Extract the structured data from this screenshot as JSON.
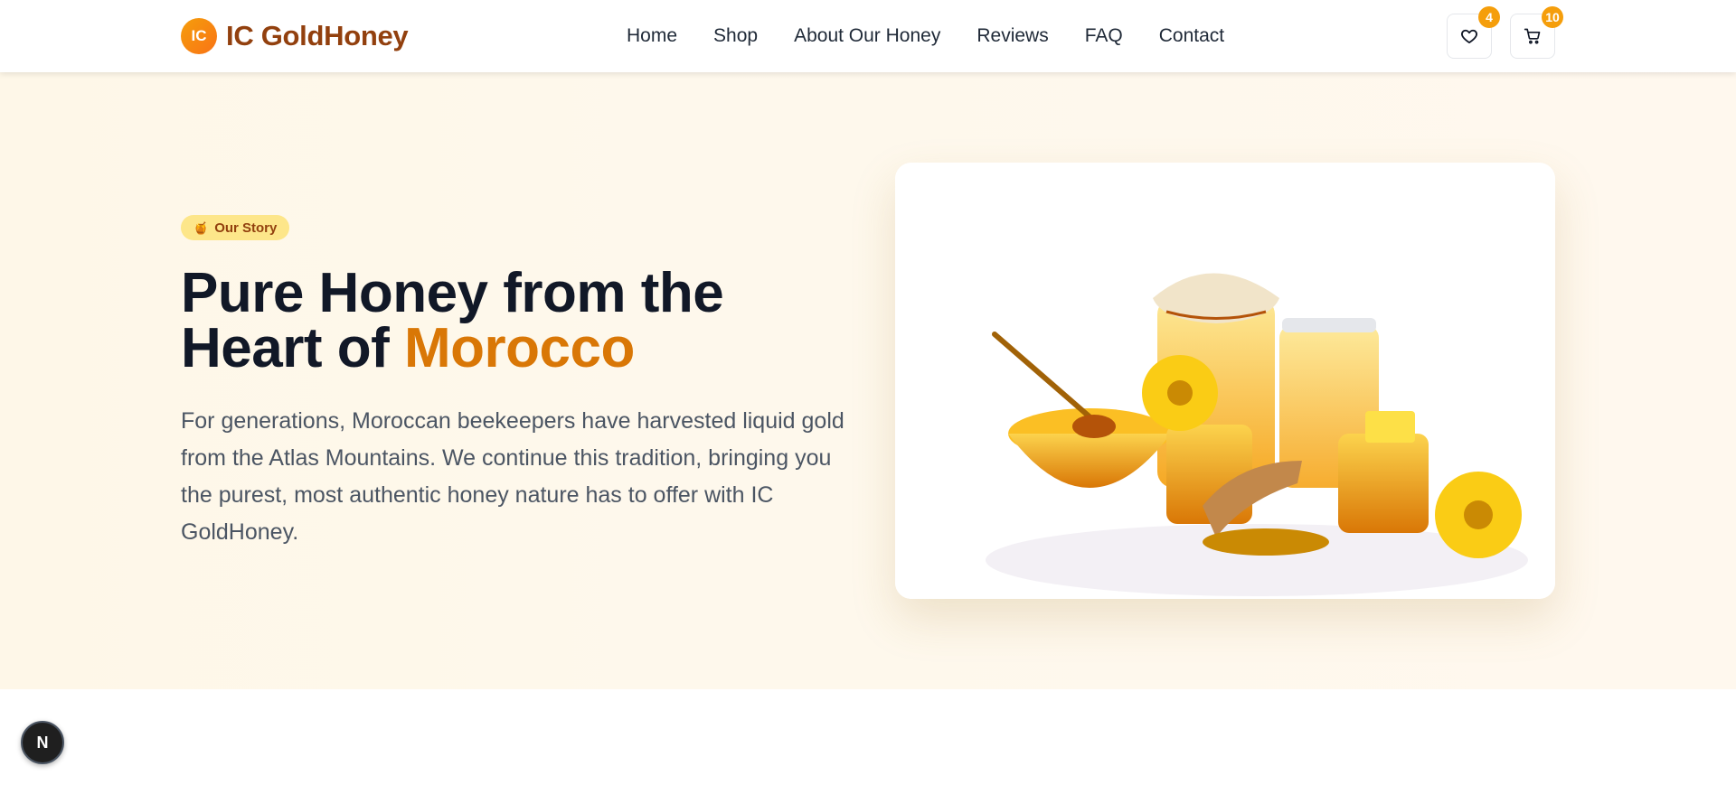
{
  "brand": {
    "badge": "IC",
    "name": "IC GoldHoney"
  },
  "nav": {
    "items": [
      "Home",
      "Shop",
      "About Our Honey",
      "Reviews",
      "FAQ",
      "Contact"
    ]
  },
  "header_actions": {
    "wishlist_icon": "heart-icon",
    "wishlist_count": "4",
    "cart_icon": "cart-icon",
    "cart_count": "10"
  },
  "hero": {
    "badge_icon": "honeypot-icon",
    "badge_label": "Our Story",
    "title_line1": "Pure Honey from the",
    "title_line2_prefix": "Heart of ",
    "title_line2_accent": "Morocco",
    "description": "For generations, Moroccan beekeepers have harvested liquid gold from the Atlas Mountains. We continue this tradition, bringing you the purest, most authentic honey nature has to offer with IC GoldHoney."
  },
  "dev_tools": {
    "label": "N"
  },
  "colors": {
    "brand": "#92400e",
    "accent": "#d97706",
    "badge": "#f59e0b",
    "hero_bg": "#fef7e8",
    "title": "#111827"
  }
}
